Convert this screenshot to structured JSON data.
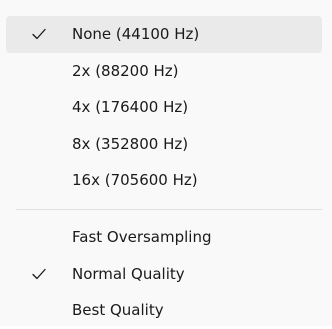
{
  "menu": {
    "sample_rate_items": [
      {
        "label": "None (44100 Hz)",
        "checked": true
      },
      {
        "label": "2x (88200 Hz)",
        "checked": false
      },
      {
        "label": "4x (176400 Hz)",
        "checked": false
      },
      {
        "label": "8x (352800 Hz)",
        "checked": false
      },
      {
        "label": "16x (705600 Hz)",
        "checked": false
      }
    ],
    "quality_items": [
      {
        "label": "Fast Oversampling",
        "checked": false
      },
      {
        "label": "Normal Quality",
        "checked": true
      },
      {
        "label": "Best Quality",
        "checked": false
      }
    ],
    "check_icon": "checkmark-icon",
    "colors": {
      "background": "#f9f9f9",
      "highlight": "#eaeaea",
      "text": "#1a1a1a",
      "separator": "#e0e0e0"
    }
  }
}
